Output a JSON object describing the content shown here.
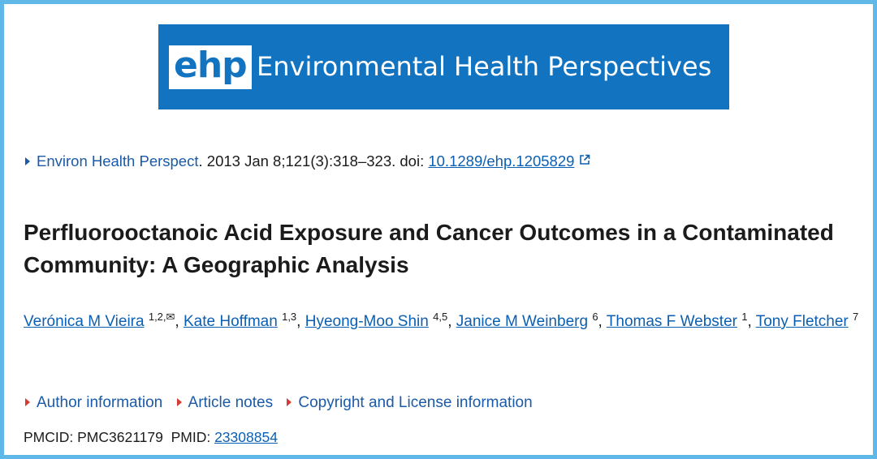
{
  "banner": {
    "logo_text": "ehp",
    "title": "Environmental Health Perspectives",
    "bg_color": "#1273c1"
  },
  "citation": {
    "journal": "Environ Health Perspect",
    "details": ". 2013 Jan 8;121(3):318–323. doi: ",
    "doi": "10.1289/ehp.1205829",
    "doi_icon": "external-link-icon"
  },
  "article": {
    "title": "Perfluorooctanoic Acid Exposure and Cancer Outcomes in a Contaminated Community: A Geographic Analysis"
  },
  "authors": [
    {
      "name": "Verónica M Vieira",
      "affil": "1,2,✉"
    },
    {
      "name": "Kate Hoffman",
      "affil": "1,3"
    },
    {
      "name": "Hyeong-Moo Shin",
      "affil": "4,5"
    },
    {
      "name": "Janice M Weinberg",
      "affil": "6"
    },
    {
      "name": "Thomas F Webster",
      "affil": "1"
    },
    {
      "name": "Tony Fletcher",
      "affil": "7"
    }
  ],
  "accordions": [
    {
      "label": "Author information"
    },
    {
      "label": "Article notes"
    },
    {
      "label": "Copyright and License information"
    }
  ],
  "ids": {
    "pmcid_label": "PMCID: ",
    "pmcid": "PMC3621179",
    "pmid_label": "PMID: ",
    "pmid": "23308854"
  },
  "colors": {
    "frame_border": "#5fb8e8",
    "link": "#0b5fb3",
    "accordion_marker": "#d83933"
  }
}
